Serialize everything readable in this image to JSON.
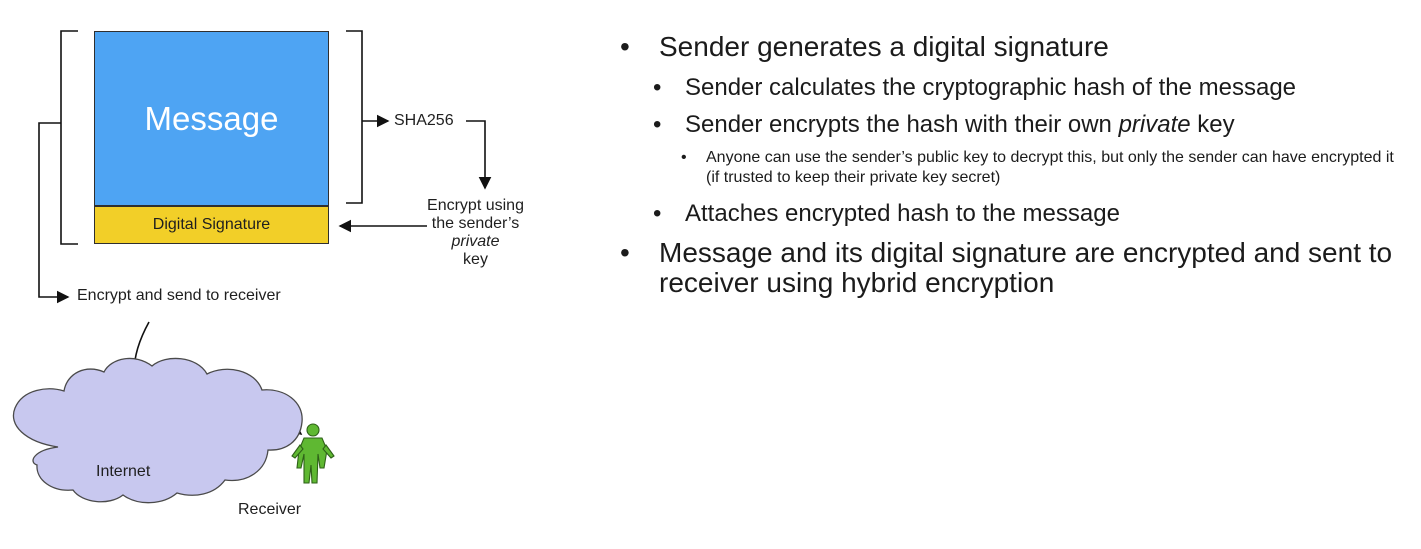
{
  "diagram": {
    "message_box": "Message",
    "signature_box": "Digital Signature",
    "sha_label": "SHA256",
    "encrypt_label": {
      "line1": "Encrypt using",
      "line2": "the sender’s",
      "line3_italic": "private",
      "line3_tail": " key"
    },
    "send_label": "Encrypt and send to receiver",
    "internet_label": "Internet",
    "receiver_label": "Receiver",
    "icons": {
      "cloud": "cloud-icon",
      "person": "person-icon"
    },
    "colors": {
      "message": "#4ea4f3",
      "signature": "#f2cf28",
      "cloud": "#c8c8ef",
      "receiver": "#5fb832"
    }
  },
  "bullets": {
    "b1": "Sender generates a digital signature",
    "b1_1": "Sender calculates the cryptographic hash of the message",
    "b1_2_prefix": "Sender encrypts the hash with their own ",
    "b1_2_italic": "private",
    "b1_2_suffix": " key",
    "b1_2_1": "Anyone can use the sender’s public key to decrypt this, but only the sender can have encrypted it (if trusted to keep their private key secret)",
    "b1_3": "Attaches encrypted hash to the message",
    "b2": "Message and its digital signature are encrypted and sent to receiver using hybrid encryption"
  }
}
